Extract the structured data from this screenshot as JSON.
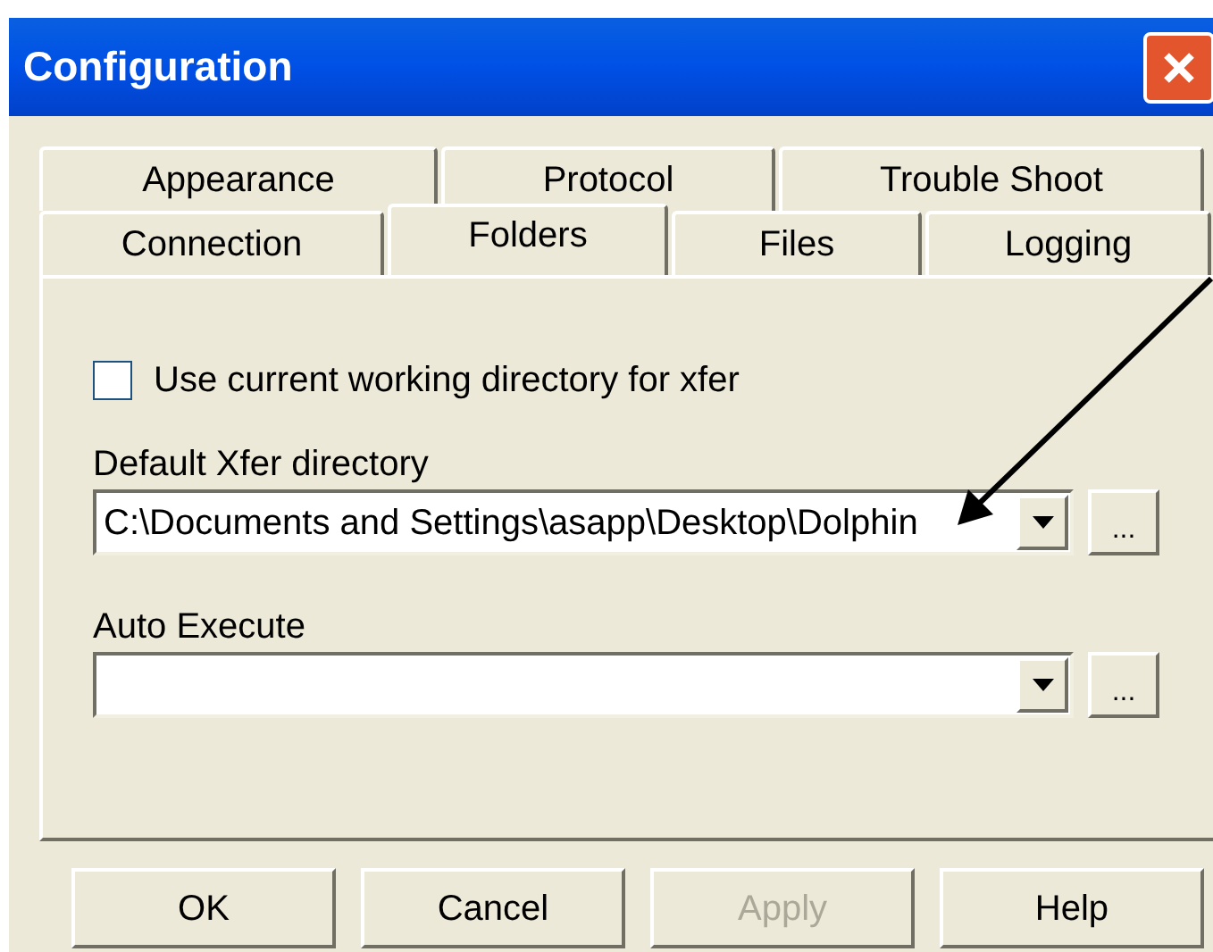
{
  "window": {
    "title": "Configuration"
  },
  "tab_rows": [
    [
      {
        "label": "Appearance",
        "selected": false
      },
      {
        "label": "Protocol",
        "selected": false
      },
      {
        "label": "Trouble Shoot",
        "selected": false
      }
    ],
    [
      {
        "label": "Connection",
        "selected": false
      },
      {
        "label": "Folders",
        "selected": true
      },
      {
        "label": "Files",
        "selected": false
      },
      {
        "label": "Logging",
        "selected": false
      }
    ]
  ],
  "use_cwd": {
    "label": "Use current working directory for xfer",
    "checked": false
  },
  "fields": [
    {
      "label": "Default Xfer directory",
      "value": "C:\\Documents and Settings\\asapp\\Desktop\\Dolphin",
      "browse": "..."
    },
    {
      "label": "Auto Execute",
      "browse": "..."
    }
  ],
  "buttons": [
    {
      "label": "OK",
      "disabled": false
    },
    {
      "label": "Cancel",
      "disabled": false
    },
    {
      "label": "Apply",
      "disabled": true
    },
    {
      "label": "Help",
      "disabled": false
    }
  ]
}
